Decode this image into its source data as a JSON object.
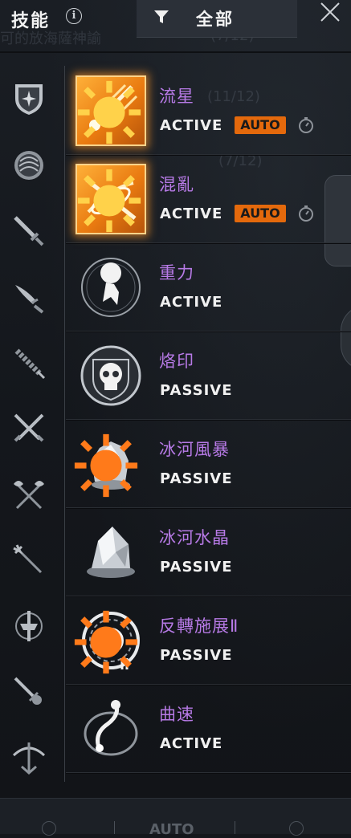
{
  "header": {
    "title": "技能",
    "filter_label": "全部",
    "ghost_texts": [
      "可的放海薩神諭",
      "(7/12)",
      "(11/12)",
      "(7/12)"
    ]
  },
  "categories": [
    {
      "name": "shield-star-icon"
    },
    {
      "name": "round-shield-icon"
    },
    {
      "name": "sword-icon"
    },
    {
      "name": "blade-icon"
    },
    {
      "name": "staff-icon"
    },
    {
      "name": "crossed-swords-icon"
    },
    {
      "name": "crossed-axes-icon"
    },
    {
      "name": "trident-icon"
    },
    {
      "name": "mace-icon"
    },
    {
      "name": "dagger-icon"
    },
    {
      "name": "crossbow-icon"
    }
  ],
  "skills": [
    {
      "name": "流星",
      "type": "ACTIVE",
      "auto": "AUTO"
    },
    {
      "name": "混亂",
      "type": "ACTIVE",
      "auto": "AUTO"
    },
    {
      "name": "重力",
      "type": "ACTIVE"
    },
    {
      "name": "烙印",
      "type": "PASSIVE"
    },
    {
      "name": "冰河風暴",
      "type": "PASSIVE"
    },
    {
      "name": "冰河水晶",
      "type": "PASSIVE"
    },
    {
      "name": "反轉施展Ⅱ",
      "type": "PASSIVE"
    },
    {
      "name": "曲速",
      "type": "ACTIVE"
    }
  ],
  "footer": {
    "label": "AUTO"
  },
  "colors": {
    "accent_orange": "#e4690c",
    "skill_name_purple": "#b77ae6",
    "background": "#14171c"
  }
}
